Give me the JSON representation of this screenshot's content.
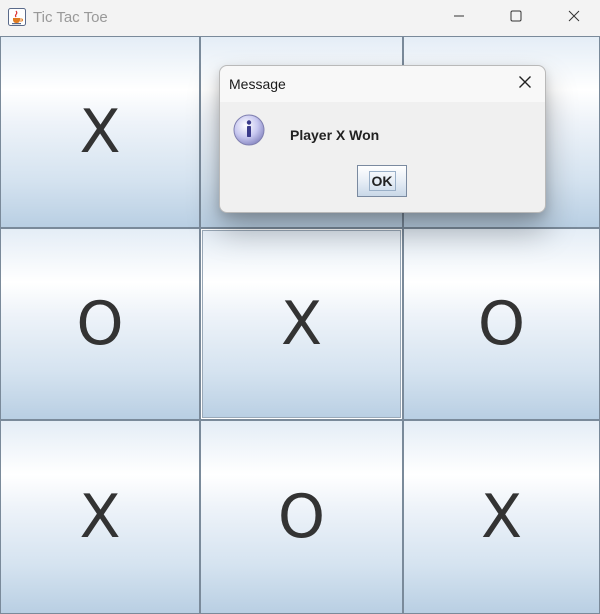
{
  "window": {
    "title": "Tic Tac Toe",
    "icon": "java-cup-icon",
    "controls": {
      "minimize": "minimize-icon",
      "maximize": "maximize-icon",
      "close": "close-icon"
    }
  },
  "board": {
    "cells": [
      {
        "row": 0,
        "col": 0,
        "mark": "X"
      },
      {
        "row": 0,
        "col": 1,
        "mark": ""
      },
      {
        "row": 0,
        "col": 2,
        "mark": ""
      },
      {
        "row": 1,
        "col": 0,
        "mark": "O"
      },
      {
        "row": 1,
        "col": 1,
        "mark": "X"
      },
      {
        "row": 1,
        "col": 2,
        "mark": "O"
      },
      {
        "row": 2,
        "col": 0,
        "mark": "X"
      },
      {
        "row": 2,
        "col": 1,
        "mark": "O"
      },
      {
        "row": 2,
        "col": 2,
        "mark": "X"
      }
    ]
  },
  "dialog": {
    "title": "Message",
    "icon": "info-icon",
    "message": "Player X Won",
    "ok_label": "OK"
  },
  "colors": {
    "board_accent": "#b9cfe3",
    "info_icon": "#c8c8f0"
  }
}
